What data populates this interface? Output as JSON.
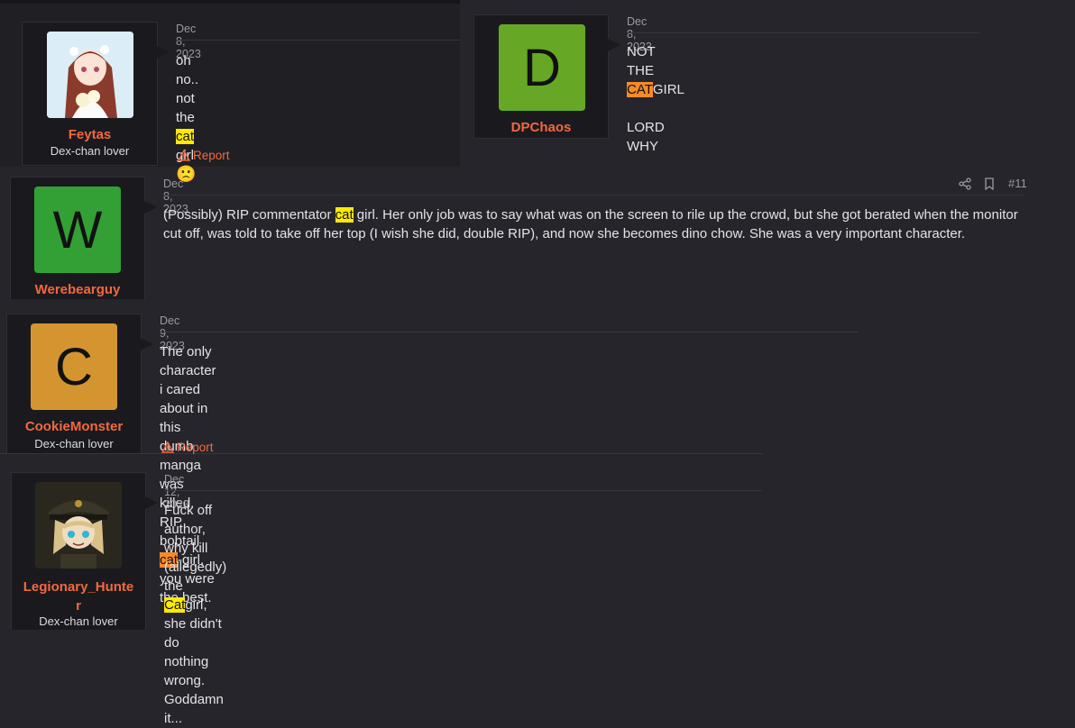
{
  "posts": [
    {
      "user": "Feytas",
      "role": "Dex-chan lover",
      "date": "Dec 8, 2023",
      "text_before": "oh no.. not the ",
      "highlight": "cat",
      "text_after": " girl ",
      "emoji": "🙁",
      "report_label": "Report",
      "avatar_type": "anime-girl-white-dress"
    },
    {
      "user": "DPChaos",
      "date": "Dec 8, 2023",
      "avatar_letter": "D",
      "avatar_color": "#66a825",
      "line1_before": "NOT THE ",
      "line1_highlight": "CAT",
      "line1_after": "GIRL",
      "line2": "LORD WHY"
    },
    {
      "user": "Werebearguy",
      "date": "Dec 8, 2023",
      "avatar_letter": "W",
      "avatar_color": "#33a035",
      "post_number": "#11",
      "text_before": "(Possibly) RIP commentator ",
      "highlight": "cat",
      "text_after": " girl. Her only job was to say what was on the screen to rile up the crowd, but she got berated when the monitor cut off, was told to take off her top (I wish she did, double RIP), and now she becomes dino chow. She was a very important character."
    },
    {
      "user": "CookieMonster",
      "role": "Dex-chan lover",
      "date": "Dec 9, 2023",
      "avatar_letter": "C",
      "avatar_color": "#d49530",
      "text_before": "The only character i cared about in this dumb manga was killed. RIP bobtail ",
      "highlight": "cat",
      "text_after": "-girl, you were the best.",
      "report_label": "Report"
    },
    {
      "user": "Legionary_Hunter",
      "user_line1": "Legionary_Hunte",
      "user_line2": "r",
      "role": "Dex-chan lover",
      "date": "Dec 12, 2023",
      "text_before": "Fuck off author, why kill (allegedly) the ",
      "highlight": "Cat",
      "text_after": "girl, she didn't do nothing wrong. Goddamn it...",
      "avatar_type": "military-cap-girl"
    }
  ],
  "icons": {
    "share": "share-icon",
    "bookmark": "bookmark-icon",
    "warning": "warning-icon"
  }
}
